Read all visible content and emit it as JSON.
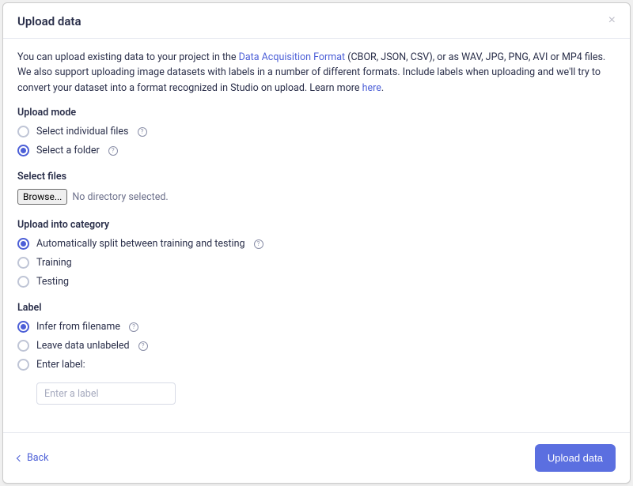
{
  "modal": {
    "title": "Upload data"
  },
  "intro": {
    "pre": "You can upload existing data to your project in the ",
    "link1": "Data Acquisition Format",
    "mid": " (CBOR, JSON, CSV), or as WAV, JPG, PNG, AVI or MP4 files. We also support uploading image datasets with labels in a number of different formats. Include labels when uploading and we'll try to convert your dataset into a format recognized in Studio on upload. Learn more ",
    "link2": "here",
    "post": "."
  },
  "upload_mode": {
    "heading": "Upload mode",
    "opt_individual": "Select individual files",
    "opt_folder": "Select a folder"
  },
  "select_files": {
    "heading": "Select files",
    "browse": "Browse...",
    "status": "No directory selected."
  },
  "category": {
    "heading": "Upload into category",
    "opt_auto": "Automatically split between training and testing",
    "opt_training": "Training",
    "opt_testing": "Testing"
  },
  "label": {
    "heading": "Label",
    "opt_infer": "Infer from filename",
    "opt_unlabeled": "Leave data unlabeled",
    "opt_enter": "Enter label:",
    "placeholder": "Enter a label"
  },
  "footer": {
    "back": "Back",
    "submit": "Upload data"
  }
}
